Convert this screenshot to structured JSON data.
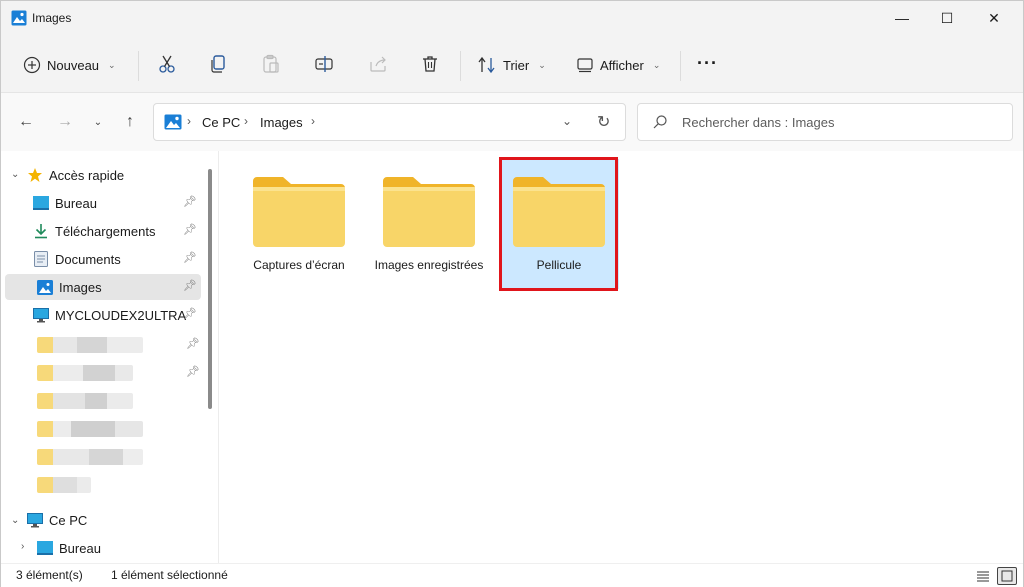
{
  "window": {
    "title": "Images",
    "controls": {
      "minimize": "—",
      "maximize": "☐",
      "close": "✕"
    }
  },
  "toolbar": {
    "new_label": "Nouveau",
    "sort_label": "Trier",
    "view_label": "Afficher",
    "more": "···"
  },
  "address_bar": {
    "crumbs": [
      "Ce PC",
      "Images"
    ]
  },
  "search": {
    "placeholder": "Rechercher dans : Images"
  },
  "sidebar": {
    "quick_access": "Accès rapide",
    "items": [
      {
        "label": "Bureau",
        "icon": "desktop-icon",
        "pinned": true
      },
      {
        "label": "Téléchargements",
        "icon": "download-icon",
        "pinned": true
      },
      {
        "label": "Documents",
        "icon": "document-icon",
        "pinned": true
      },
      {
        "label": "Images",
        "icon": "pictures-icon",
        "pinned": true,
        "selected": true
      },
      {
        "label": "MYCLOUDEX2ULTRA",
        "icon": "monitor-icon",
        "pinned": true
      }
    ],
    "this_pc": "Ce PC",
    "this_pc_items": [
      {
        "label": "Bureau",
        "icon": "desktop-icon"
      }
    ]
  },
  "content": {
    "folders": [
      {
        "label": "Captures d’écran",
        "selected": false
      },
      {
        "label": "Images enregistrées",
        "selected": false
      },
      {
        "label": "Pellicule",
        "selected": true
      }
    ]
  },
  "status": {
    "count": "3 élément(s)",
    "selection": "1 élément sélectionné"
  },
  "colors": {
    "selection_bg": "#cce8ff",
    "highlight_border": "#e0151b",
    "folder_yellow": "#f8d568",
    "folder_tab": "#f0b429"
  }
}
